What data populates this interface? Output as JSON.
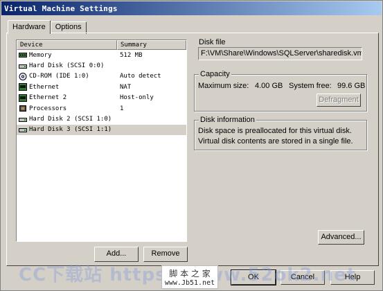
{
  "window": {
    "title": "Virtual Machine Settings"
  },
  "tabs": [
    {
      "label": "Hardware"
    },
    {
      "label": "Options"
    }
  ],
  "device_list": {
    "headers": {
      "device": "Device",
      "summary": "Summary"
    },
    "rows": [
      {
        "device": "Memory",
        "summary": "512 MB",
        "icon": "memory-icon"
      },
      {
        "device": "Hard Disk (SCSI 0:0)",
        "summary": "",
        "icon": "hard-disk-icon"
      },
      {
        "device": "CD-ROM (IDE 1:0)",
        "summary": "Auto detect",
        "icon": "cdrom-icon"
      },
      {
        "device": "Ethernet",
        "summary": "NAT",
        "icon": "ethernet-icon"
      },
      {
        "device": "Ethernet 2",
        "summary": "Host-only",
        "icon": "ethernet-icon"
      },
      {
        "device": "Processors",
        "summary": "1",
        "icon": "processor-icon"
      },
      {
        "device": "Hard Disk 2 (SCSI 1:0)",
        "summary": "",
        "icon": "hard-disk-icon"
      },
      {
        "device": "Hard Disk 3 (SCSI 1:1)",
        "summary": "",
        "icon": "hard-disk-icon",
        "selected": true
      }
    ],
    "add_label": "Add...",
    "remove_label": "Remove"
  },
  "disk_file": {
    "title": "Disk file",
    "path": "F:\\VM\\Share\\Windows\\SQLServer\\sharedisk.vmdk"
  },
  "capacity": {
    "title": "Capacity",
    "max_size_label": "Maximum size:",
    "max_size_value": "4.00 GB",
    "free_label": "System free:",
    "free_value": "99.6 GB",
    "defragment_label": "Defragment"
  },
  "disk_info": {
    "title": "Disk information",
    "line1": "Disk space is preallocated for this virtual disk.",
    "line2": "Virtual disk contents are stored in a single file."
  },
  "buttons": {
    "advanced": "Advanced...",
    "ok": "OK",
    "cancel": "Cancel",
    "help": "Help"
  },
  "watermark": {
    "text": "CC下载站 https://www.52ok2.net",
    "box_line1": "脚 本 之 家",
    "box_line2": "www.Jb51.net"
  }
}
